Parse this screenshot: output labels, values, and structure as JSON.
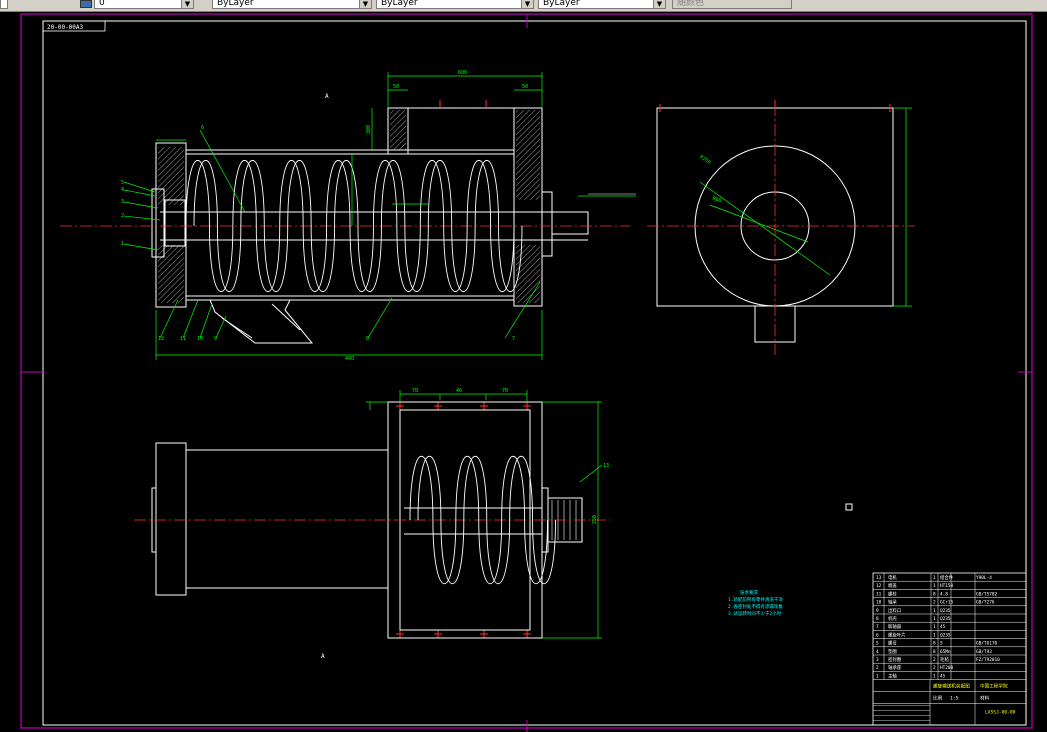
{
  "toolbar": {
    "layer_field": "0",
    "color_field": "ByLayer",
    "linetype_field": "ByLayer",
    "lineweight_field": "ByLayer",
    "plotstyle_field": "随颜色"
  },
  "drawing": {
    "frame_label": "20-00-00A3",
    "view_label_top": "A",
    "view_label_bottom": "A",
    "dim_top_overall": "600",
    "dim_left_small": "50",
    "dim_right_small": "50",
    "dim_side_height": "300",
    "dim_bottom_left": "70",
    "dim_bottom_mid": "46",
    "dim_bottom_right": "70",
    "dim_bottom_side": "250",
    "dim_bottom_overall": "400",
    "balloon_13": "13",
    "balloon_1": "1",
    "balloon_2": "2",
    "balloon_3": "3",
    "balloon_4": "4",
    "balloon_5": "5",
    "balloon_6": "6",
    "balloon_7": "7",
    "balloon_8": "8",
    "balloon_9": "9",
    "balloon_10": "10",
    "balloon_11": "11",
    "balloon_12": "12",
    "radius_outer": "R150",
    "radius_inner": "R60"
  },
  "notes": {
    "title": "技术要求",
    "line1": "1.装配前所有零件清洗干净",
    "line2": "2.各密封处不得有渗漏现象",
    "line3": "3.试运转时间不少于2小时"
  },
  "title_block": {
    "drawing_name": "螺旋输送机装配图",
    "school": "中国工程学院",
    "drawing_no": "LXSSJ-00-00",
    "scale_label": "比例",
    "scale_value": "1:5",
    "material_label": "材料",
    "rows": [
      {
        "no": "13",
        "name": "电机",
        "qty": "1",
        "mat": "组合件",
        "std": "Y90L-4"
      },
      {
        "no": "12",
        "name": "端盖",
        "qty": "1",
        "mat": "HT150",
        "std": ""
      },
      {
        "no": "11",
        "name": "螺栓",
        "qty": "8",
        "mat": "4.8",
        "std": "GB/T5782"
      },
      {
        "no": "10",
        "name": "轴承",
        "qty": "2",
        "mat": "GCr15",
        "std": "GB/T276"
      },
      {
        "no": "9",
        "name": "出料口",
        "qty": "1",
        "mat": "Q235",
        "std": ""
      },
      {
        "no": "8",
        "name": "机壳",
        "qty": "1",
        "mat": "Q235",
        "std": ""
      },
      {
        "no": "7",
        "name": "联轴器",
        "qty": "1",
        "mat": "45",
        "std": ""
      },
      {
        "no": "6",
        "name": "螺旋叶片",
        "qty": "1",
        "mat": "Q235",
        "std": ""
      },
      {
        "no": "5",
        "name": "螺母",
        "qty": "8",
        "mat": "5",
        "std": "GB/T6170"
      },
      {
        "no": "4",
        "name": "垫圈",
        "qty": "8",
        "mat": "65Mn",
        "std": "GB/T93"
      },
      {
        "no": "3",
        "name": "密封圈",
        "qty": "2",
        "mat": "毛毡",
        "std": "FZ/T92010"
      },
      {
        "no": "2",
        "name": "轴承座",
        "qty": "2",
        "mat": "HT200",
        "std": ""
      },
      {
        "no": "1",
        "name": "主轴",
        "qty": "1",
        "mat": "45",
        "std": ""
      }
    ]
  }
}
